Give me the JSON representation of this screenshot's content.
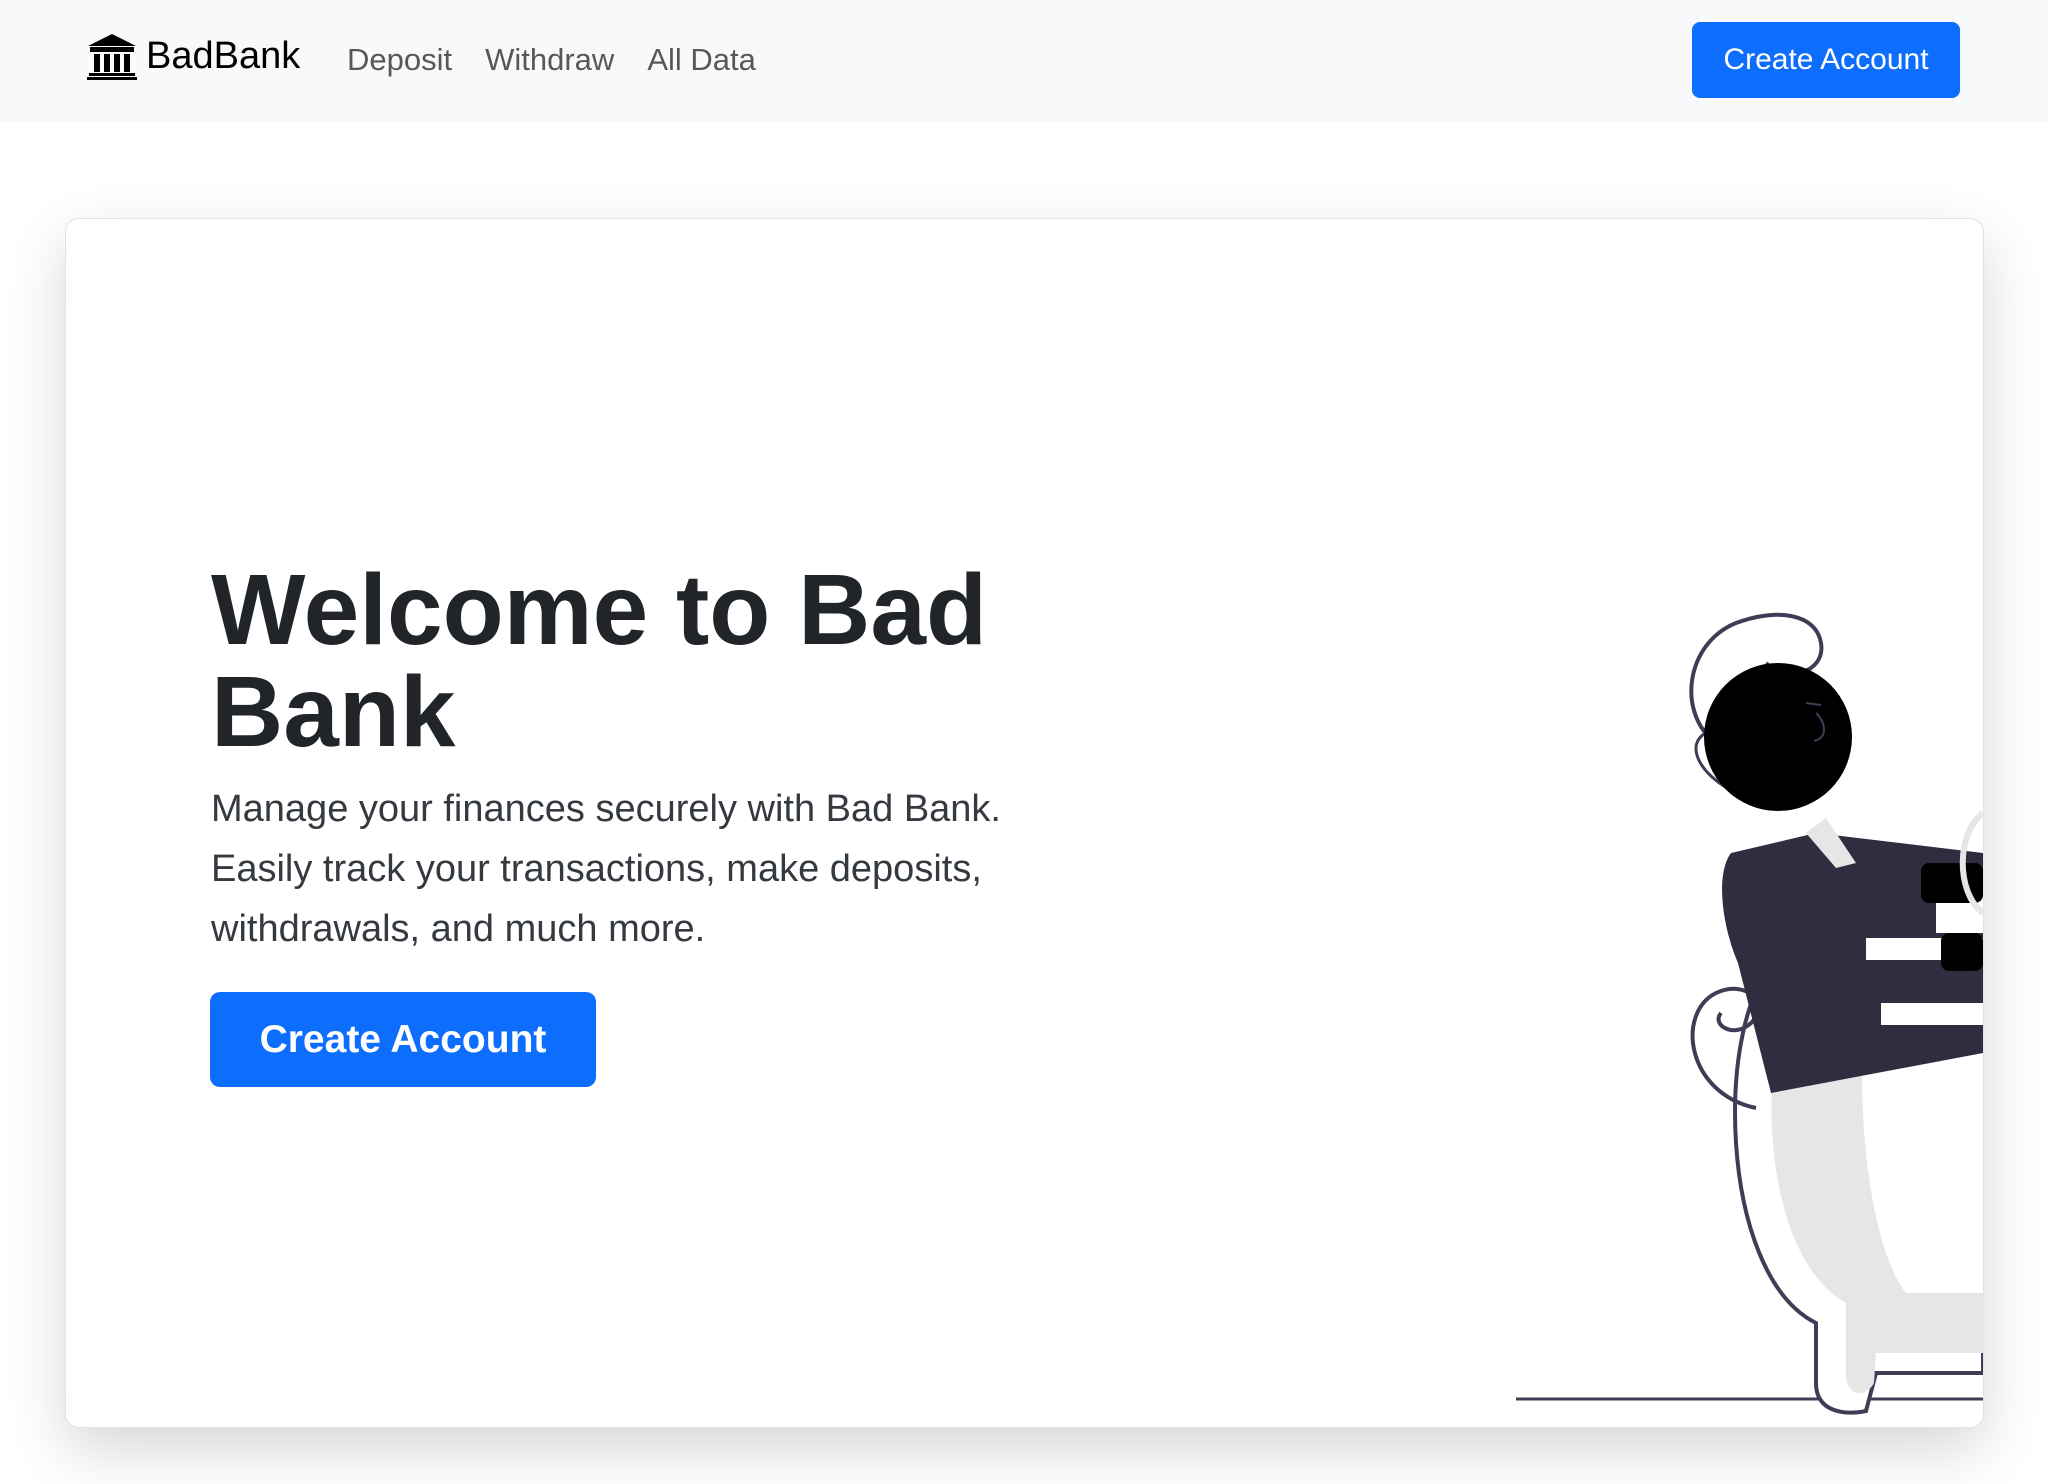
{
  "navbar": {
    "brand_icon": "bank-icon",
    "brand_label": "BadBank",
    "links": [
      {
        "label": "Deposit"
      },
      {
        "label": "Withdraw"
      },
      {
        "label": "All Data"
      }
    ],
    "cta_label": "Create Account"
  },
  "hero": {
    "title": "Welcome to Bad Bank",
    "lead": "Manage your finances securely with Bad Bank. Easily track your transactions, make deposits, withdrawals, and much more.",
    "cta_label": "Create Account",
    "illustration": "person-with-piggy-bank-illustration"
  },
  "colors": {
    "primary": "#0d6efd",
    "navbar_bg": "#f8f9fa",
    "text_dark": "#212529",
    "illustration_dark": "#2f2e41",
    "illustration_light": "#e6e6e6"
  }
}
